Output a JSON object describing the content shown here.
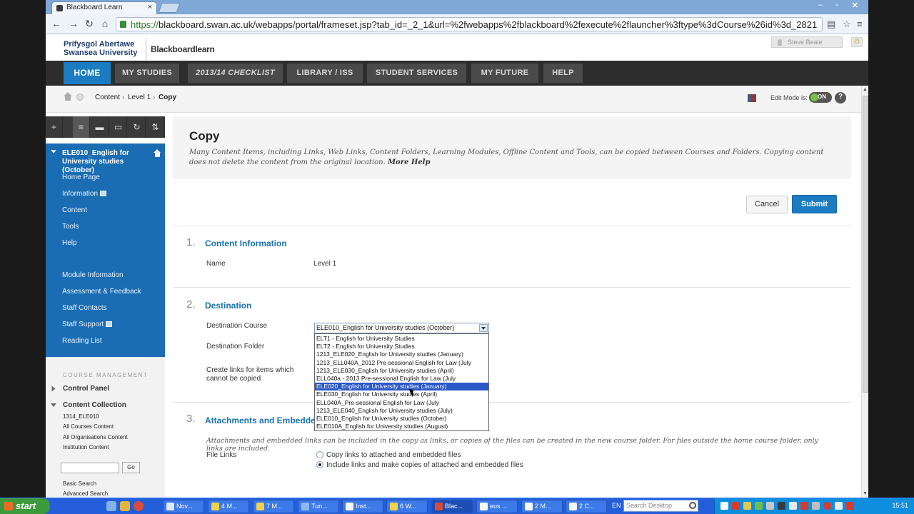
{
  "browser": {
    "tab_title": "Blackboard Learn",
    "tab_close": "×",
    "url_scheme": "https://",
    "url_rest": "blackboard.swan.ac.uk/webapps/portal/frameset.jsp?tab_id=_2_1&url=%2fwebapps%2fblackboard%2fexecute%2flauncher%3ftype%3dCourse%26id%3d_2821",
    "win_min": "–",
    "win_max": "▫",
    "win_close": "✕"
  },
  "header": {
    "university_line1": "Prifysgol Abertawe",
    "university_line2": "Swansea University",
    "product": "Blackboardlearn",
    "user_name": "Steve Beale"
  },
  "nav_tabs": [
    "HOME",
    "MY STUDIES",
    "2013/14 CHECKLIST",
    "LIBRARY / ISS",
    "STUDENT SERVICES",
    "MY FUTURE",
    "HELP"
  ],
  "breadcrumb": {
    "items": [
      "Content",
      "Level 1",
      "Copy"
    ],
    "edit_mode_label": "Edit Mode is:",
    "edit_mode_value": "ON",
    "help": "?"
  },
  "sidebar": {
    "tools": [
      "+",
      "",
      "≡",
      "▬",
      "▭",
      "↻",
      "⇅"
    ],
    "course_title": "ELE010_English for University studies (October)",
    "menu_items": [
      "Home Page",
      "Information",
      "Content",
      "Tools",
      "Help"
    ],
    "menu_items_2": [
      "Module Information",
      "Assessment & Feedback",
      "Staff Contacts",
      "Staff Support",
      "Reading List"
    ],
    "course_management": "COURSE MANAGEMENT",
    "control_panel": "Control Panel",
    "content_collection": "Content Collection",
    "cc_links": [
      "1314_ELE010",
      "All Courses Content",
      "All Organisations Content",
      "Institution Content"
    ],
    "search_go": "Go",
    "search_links": [
      "Basic Search",
      "Advanced Search"
    ]
  },
  "page": {
    "title": "Copy",
    "description": "Many Content Items, including Links, Web Links, Content Folders, Learning Modules, Offline Content and Tools, can be copied between Courses and Folders. Copying content does not delete the content from the original location.",
    "more_help": "More Help",
    "cancel": "Cancel",
    "submit": "Submit",
    "section1_num": "1.",
    "section1_title": "Content Information",
    "name_label": "Name",
    "name_value": "Level 1",
    "section2_num": "2.",
    "section2_title": "Destination",
    "dest_course_label": "Destination Course",
    "dest_folder_label": "Destination Folder",
    "create_links_label": "Create links for items which cannot be copied",
    "dest_course_value": "ELE010_English for University studies (October)",
    "dropdown_options": [
      "ELT1 - English for University Studies",
      "ELT2 - English for University Studies",
      "1213_ELE020_English for University studies (January)",
      "1213_ELL040A_2012 Pre-sessional English for Law (July",
      "1213_ELE030_English for University studies (April)",
      "ELL040a - 2013 Pre-sessional English for Law (July",
      "ELE020_English for University studies (January)",
      "ELE030_English for University studies (April)",
      "ELL040A_Pre-sessional English for Law (July",
      "1213_ELE040_English for University studies (July)",
      "ELE010_English for University studies (October)",
      "ELE010A_English for University studies (August)"
    ],
    "dropdown_selected_index": 6,
    "section3_num": "3.",
    "section3_title": "Attachments and Embedded Links",
    "attach_desc": "Attachments and embedded links can be included in the copy as links, or copies of the files can be created in the new course folder. For files outside the home course folder, only links are included.",
    "file_links_label": "File Links",
    "radio_options": [
      "Copy links to attached and embedded files",
      "Include links and make copies of attached and embedded files"
    ]
  },
  "taskbar": {
    "start": "start",
    "tasks": [
      "Nov...",
      "4 M...",
      "7 M...",
      "Tun...",
      "Inst...",
      "6 W...",
      "Blac...",
      "eus ...",
      "2 M...",
      "2 C..."
    ],
    "lang": "EN",
    "search_placeholder": "Search Desktop",
    "clock": "15:51"
  },
  "colors": {
    "accent": "#1b7cc1",
    "course_menu": "#1a6db3",
    "nav_bar": "#2d2d2d",
    "taskbar": "#245edb"
  }
}
